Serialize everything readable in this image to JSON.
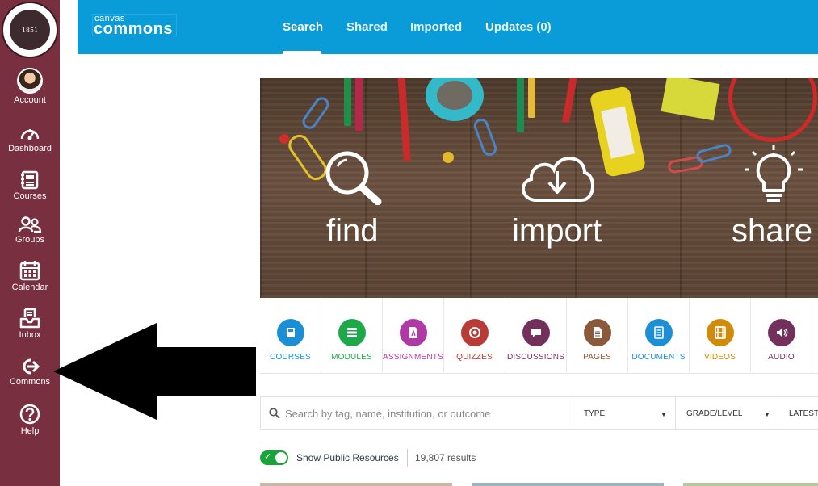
{
  "global_nav": {
    "seal_year": "1851",
    "items": [
      {
        "label": "Account",
        "icon": "user-avatar"
      },
      {
        "label": "Dashboard",
        "icon": "dashboard-icon"
      },
      {
        "label": "Courses",
        "icon": "courses-icon"
      },
      {
        "label": "Groups",
        "icon": "groups-icon"
      },
      {
        "label": "Calendar",
        "icon": "calendar-icon"
      },
      {
        "label": "Inbox",
        "icon": "inbox-icon"
      },
      {
        "label": "Commons",
        "icon": "commons-icon"
      },
      {
        "label": "Help",
        "icon": "help-icon"
      }
    ]
  },
  "header": {
    "logo_small": "canvas",
    "logo_big": "commons",
    "tabs": [
      {
        "label": "Search",
        "active": true
      },
      {
        "label": "Shared",
        "active": false
      },
      {
        "label": "Imported",
        "active": false
      },
      {
        "label": "Updates (0)",
        "active": false
      }
    ],
    "color": "#0a9bd9"
  },
  "hero": {
    "words": [
      "find",
      "import",
      "share"
    ]
  },
  "categories": [
    {
      "label": "COURSES",
      "color": "#1b8fd6",
      "icon": "courses-icon"
    },
    {
      "label": "MODULES",
      "color": "#1da94a",
      "icon": "modules-icon"
    },
    {
      "label": "ASSIGNMENTS",
      "color": "#b139a6",
      "icon": "assignments-icon"
    },
    {
      "label": "QUIZZES",
      "color": "#b83b36",
      "icon": "quizzes-icon"
    },
    {
      "label": "DISCUSSIONS",
      "color": "#74305c",
      "icon": "discussions-icon"
    },
    {
      "label": "PAGES",
      "color": "#8a5a3a",
      "icon": "pages-icon"
    },
    {
      "label": "DOCUMENTS",
      "color": "#1d8fd5",
      "icon": "documents-icon"
    },
    {
      "label": "VIDEOS",
      "color": "#d18a0a",
      "icon": "videos-icon"
    },
    {
      "label": "AUDIO",
      "color": "#74305c",
      "icon": "audio-icon"
    }
  ],
  "search": {
    "placeholder": "Search by tag, name, institution, or outcome",
    "filters": [
      {
        "label": "TYPE"
      },
      {
        "label": "GRADE/LEVEL"
      },
      {
        "label": "LATEST"
      }
    ]
  },
  "results_bar": {
    "toggle_label": "Show Public Resources",
    "toggle_on": true,
    "results_text": "19,807 results"
  }
}
